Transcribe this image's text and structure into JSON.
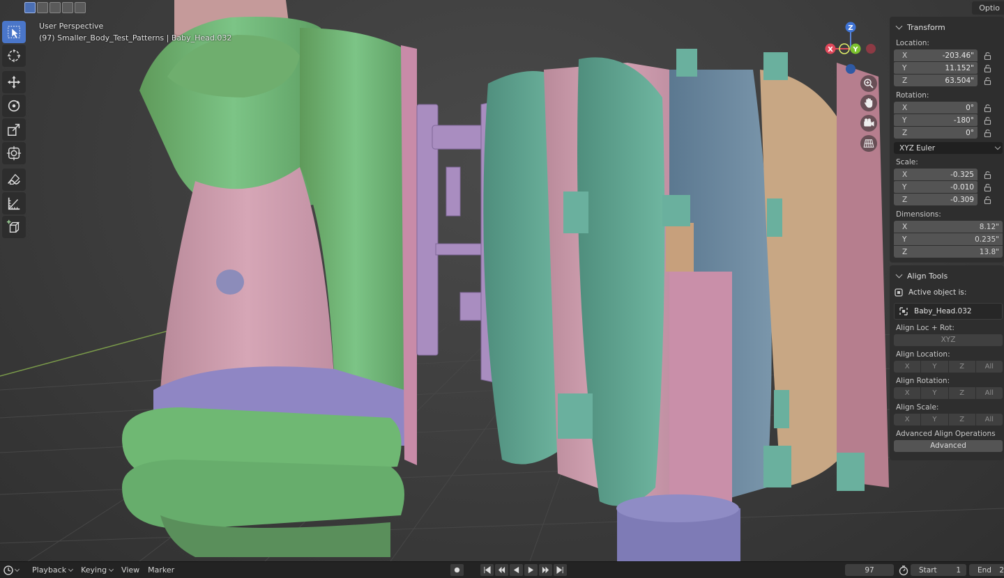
{
  "viewport": {
    "perspective_label": "User Perspective",
    "object_label": "(97) Smaller_Body_Test_Patterns | Baby_Head.032",
    "options_label": "Optio"
  },
  "gizmo": {
    "z_label": "Z",
    "y_label": "Y",
    "x_label": "X"
  },
  "icons": {
    "header": [
      "select-box-icon",
      "select-extend-icon",
      "select-subtract-icon",
      "select-invert-icon",
      "select-intersect-icon"
    ],
    "tools": [
      "select-cursor-icon",
      "cursor-icon",
      "move-icon",
      "rotate-icon",
      "scale-icon",
      "transform-icon",
      "annotate-icon",
      "measure-icon",
      "add-cube-icon"
    ],
    "nav": [
      "zoom-icon",
      "hand-icon",
      "camera-icon",
      "grid-icon"
    ]
  },
  "transform_panel": {
    "title": "Transform",
    "location_label": "Location:",
    "location": [
      {
        "axis": "X",
        "value": "-203.46\""
      },
      {
        "axis": "Y",
        "value": "11.152\""
      },
      {
        "axis": "Z",
        "value": "63.504\""
      }
    ],
    "rotation_label": "Rotation:",
    "rotation": [
      {
        "axis": "X",
        "value": "0°"
      },
      {
        "axis": "Y",
        "value": "-180°"
      },
      {
        "axis": "Z",
        "value": "0°"
      }
    ],
    "rotation_mode": "XYZ Euler",
    "scale_label": "Scale:",
    "scale": [
      {
        "axis": "X",
        "value": "-0.325"
      },
      {
        "axis": "Y",
        "value": "-0.010"
      },
      {
        "axis": "Z",
        "value": "-0.309"
      }
    ],
    "dimensions_label": "Dimensions:",
    "dimensions": [
      {
        "axis": "X",
        "value": "8.12\""
      },
      {
        "axis": "Y",
        "value": "0.235\""
      },
      {
        "axis": "Z",
        "value": "13.8\""
      }
    ]
  },
  "align_panel": {
    "title": "Align Tools",
    "active_object_label": "Active object is:",
    "active_object_name": "Baby_Head.032",
    "loc_rot_label": "Align Loc + Rot:",
    "xyz_button": "XYZ",
    "location_label": "Align Location:",
    "rotation_label": "Align Rotation:",
    "scale_label": "Align Scale:",
    "axis_buttons": [
      "X",
      "Y",
      "Z",
      "All"
    ],
    "advanced_label": "Advanced Align Operations",
    "advanced_button": "Advanced"
  },
  "timeline": {
    "playback": "Playback",
    "keying": "Keying",
    "view": "View",
    "marker": "Marker",
    "current_frame": "97",
    "start_label": "Start",
    "start_value": "1",
    "end_label": "End",
    "end_value": "2"
  }
}
